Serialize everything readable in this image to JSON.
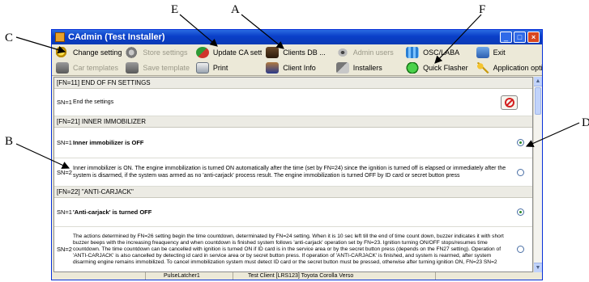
{
  "window": {
    "title": "CAdmin (Test Installer)"
  },
  "callouts": {
    "a": "A",
    "b": "B",
    "c": "C",
    "d": "D",
    "e": "E",
    "f": "F"
  },
  "toolbar": {
    "row1": [
      {
        "label": "Change settings",
        "icon": "gear-icon",
        "disabled": false
      },
      {
        "label": "Store settings",
        "icon": "gears-icon",
        "disabled": true
      },
      {
        "label": "Update CA settings",
        "icon": "update-icon",
        "disabled": false
      },
      {
        "label": "Clients DB ...",
        "icon": "database-icon",
        "disabled": false
      },
      {
        "label": "Admin users",
        "icon": "eye-icon",
        "disabled": true
      },
      {
        "label": "OSC/LABA",
        "icon": "oscilloscope-icon",
        "disabled": false
      },
      {
        "label": "Exit",
        "icon": "exit-icon",
        "disabled": false
      }
    ],
    "row2": [
      {
        "label": "Car templates",
        "icon": "car-icon",
        "disabled": true
      },
      {
        "label": "Save template",
        "icon": "template-icon",
        "disabled": true
      },
      {
        "label": "Print",
        "icon": "printer-icon",
        "disabled": false
      },
      {
        "label": "Client Info",
        "icon": "client-info-icon",
        "disabled": false
      },
      {
        "label": "Installers",
        "icon": "tools-icon",
        "disabled": false
      },
      {
        "label": "Quick Flasher",
        "icon": "flash-icon",
        "disabled": false
      },
      {
        "label": "Application options",
        "icon": "key-icon",
        "disabled": false
      }
    ]
  },
  "sections": {
    "fn11": {
      "header": "[FN=11]   END OF FN SETTINGS",
      "sn1": {
        "sn": "SN=1",
        "text": "End the settings"
      }
    },
    "fn21": {
      "header": "[FN=21]   INNER IMMOBILIZER",
      "sn1": {
        "sn": "SN=1",
        "text": "Inner immobilizer is OFF",
        "selected": true
      },
      "sn2": {
        "sn": "SN=2",
        "text": "Inner immobilizer is ON. The engine immobilization is turned ON automatically after the time (set by FN=24) since the ignition is turned off is elapsed or immediately after the system is disarmed, if the system was armed as no 'anti-carjack' process result. The engine immobilization is turned OFF by ID card or secret button press",
        "selected": false
      }
    },
    "fn22": {
      "header": "[FN=22]   \"ANTI-CARJACK\"",
      "sn1": {
        "sn": "SN=1",
        "text": "'Anti-carjack' is turned OFF",
        "selected": true
      },
      "sn2": {
        "sn": "SN=2",
        "text": "The actions determined by FN=26 setting begin the time countdown, determinated by FN=24 setting. When it is 10 sec left till the end of time count down, buzzer indicates it with short buzzer beeps with the increasing freaquency and when countdown is finished system follows 'anti-carjack' operation set by FN=23. Ignition turning ON/OFF stops/resumes time countdown. The time countdown can be cancelled with ignition is turned ON if ID card is in the service area or by the secret button press (depends on the FN27 setting). Operation of 'ANTI-CARJACK' is also cancelled by detecting id card in service area or by secret button press. If operation of 'ANTI-CARJACK' is finished, and system is rearmed, after system disarming engine remains immobilized. To cancel immobilization system must detect ID card or the secret button must be pressed, otherwise after turning ignition ON, FN=23 SN=2",
        "selected": false
      }
    }
  },
  "statusbar": {
    "cell1": "",
    "cell2": "PulseLatcher1",
    "cell3": "Test Client  [LRS123]  Toyota Corolla Verso",
    "cell4": ""
  }
}
